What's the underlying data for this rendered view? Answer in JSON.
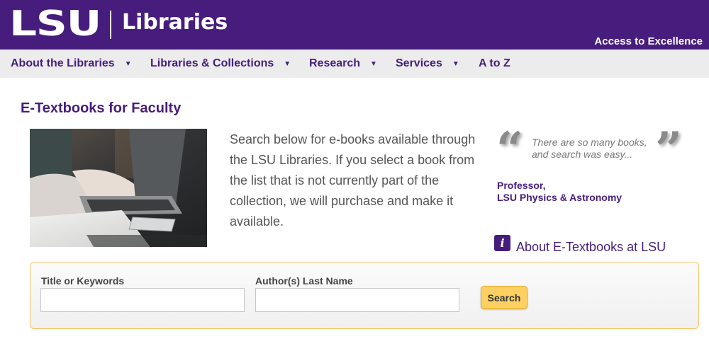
{
  "header": {
    "logo_text": "LSU",
    "libraries_text": "Libraries",
    "tagline": "Access to Excellence",
    "brand_color": "#461d7c"
  },
  "nav": {
    "items": [
      {
        "label": "About the Libraries",
        "has_dropdown": true
      },
      {
        "label": "Libraries & Collections",
        "has_dropdown": true
      },
      {
        "label": "Research",
        "has_dropdown": true
      },
      {
        "label": "Services",
        "has_dropdown": true
      },
      {
        "label": "A to Z",
        "has_dropdown": false
      }
    ],
    "dropdown_icon": "caret-down-icon"
  },
  "page": {
    "title": "E-Textbooks for Faculty",
    "intro": "Search below for e-books available through the LSU Libraries. If you select a book from the list that is not currently part of the collection, we will purchase and make it available."
  },
  "quote": {
    "text": "There are so many books, and search was easy...",
    "author_line1": "Professor,",
    "author_line2": "LSU Physics & Astronomy"
  },
  "about_link": {
    "icon": "info-icon",
    "icon_glyph": "i",
    "label": "About E-Textbooks at LSU"
  },
  "search": {
    "title_label": "Title or Keywords",
    "title_value": "",
    "title_placeholder": "",
    "author_label": "Author(s) Last Name",
    "author_value": "",
    "author_placeholder": "",
    "button_label": "Search",
    "button_color": "#fdd161",
    "border_color": "#f4c565"
  }
}
